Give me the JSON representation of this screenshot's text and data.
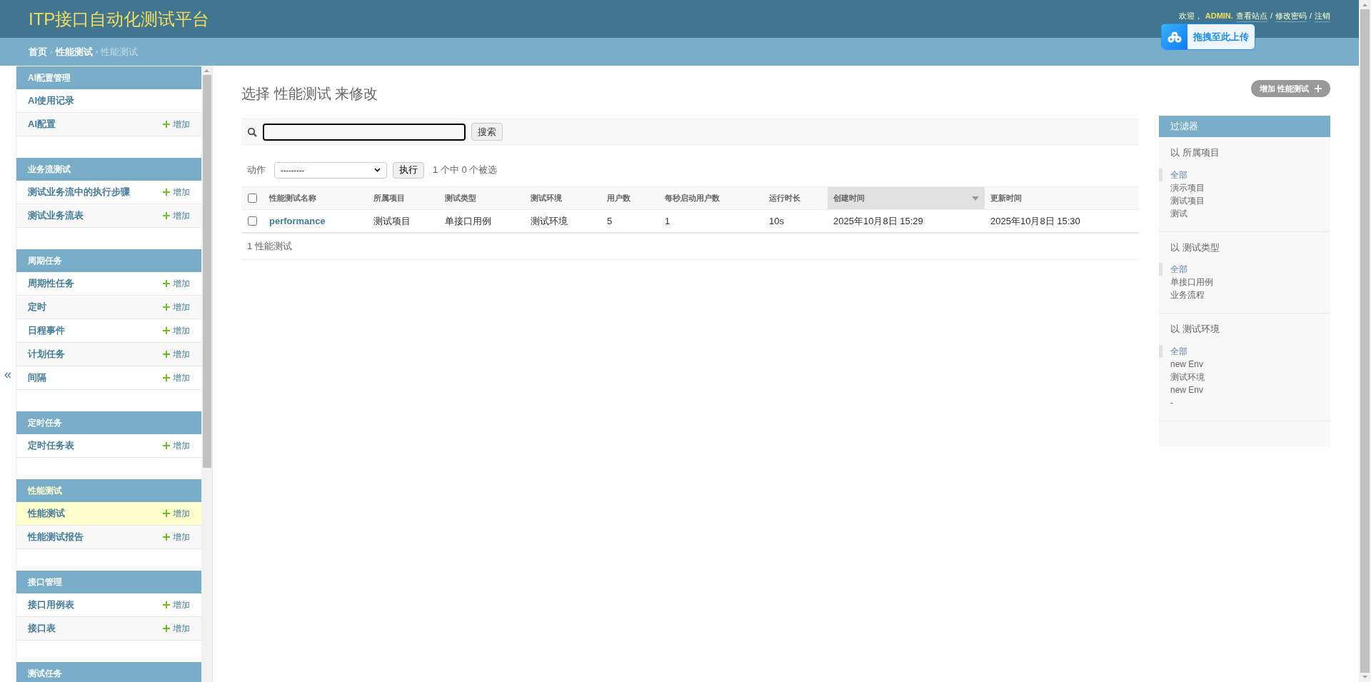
{
  "header": {
    "title": "ITP接口自动化测试平台",
    "welcome": "欢迎，",
    "user": "ADMIN.",
    "links": [
      "查看站点",
      "修改密码",
      "注销"
    ],
    "separator": "/"
  },
  "upload_widget": {
    "label": "拖拽至此上传"
  },
  "breadcrumbs": [
    {
      "label": "首页",
      "current": false
    },
    {
      "label": "性能测试",
      "current": false
    },
    {
      "label": "性能测试",
      "current": true
    }
  ],
  "breadcrumb_separator": "›",
  "collapse_button": "«",
  "sidebar": {
    "sections": [
      {
        "title": "AI配置管理",
        "current": false,
        "items": [
          {
            "label": "AI使用记录",
            "selected": false
          },
          {
            "label": "AI配置",
            "selected": false,
            "add": "增加"
          }
        ]
      },
      {
        "title": "业务流测试",
        "current": false,
        "items": [
          {
            "label": "测试业务流中的执行步骤",
            "selected": false,
            "add": "增加"
          },
          {
            "label": "测试业务流表",
            "selected": false,
            "add": "增加"
          }
        ]
      },
      {
        "title": "周期任务",
        "current": false,
        "items": [
          {
            "label": "周期性任务",
            "selected": false,
            "add": "增加"
          },
          {
            "label": "定时",
            "selected": false,
            "add": "增加"
          },
          {
            "label": "日程事件",
            "selected": false,
            "add": "增加"
          },
          {
            "label": "计划任务",
            "selected": false,
            "add": "增加"
          },
          {
            "label": "间隔",
            "selected": false,
            "add": "增加"
          }
        ]
      },
      {
        "title": "定时任务",
        "current": false,
        "items": [
          {
            "label": "定时任务表",
            "selected": false,
            "add": "增加"
          }
        ]
      },
      {
        "title": "性能测试",
        "current": true,
        "items": [
          {
            "label": "性能测试",
            "selected": true,
            "add": "增加"
          },
          {
            "label": "性能测试报告",
            "selected": false,
            "add": "增加"
          }
        ]
      },
      {
        "title": "接口管理",
        "current": false,
        "items": [
          {
            "label": "接口用例表",
            "selected": false,
            "add": "增加"
          },
          {
            "label": "接口表",
            "selected": false,
            "add": "增加"
          }
        ]
      },
      {
        "title": "测试任务",
        "current": false
      }
    ]
  },
  "page_title": "选择 性能测试 来修改",
  "add_button": "增加 性能测试",
  "search": {
    "button": "搜索"
  },
  "actions": {
    "label": "动作",
    "value": "---------",
    "go": "执行",
    "counter": "1 个中 0 个被选"
  },
  "table": {
    "select_all": {
      "checked": false
    },
    "columns": [
      {
        "label": "性能测试名称",
        "sorted": false
      },
      {
        "label": "所属项目",
        "sorted": false
      },
      {
        "label": "测试类型",
        "sorted": false
      },
      {
        "label": "测试环境",
        "sorted": false
      },
      {
        "label": "用户数",
        "sorted": false
      },
      {
        "label": "每秒启动用户数",
        "sorted": false
      },
      {
        "label": "运行时长",
        "sorted": false
      },
      {
        "label": "创建时间",
        "sorted": true
      },
      {
        "label": "更新时间",
        "sorted": false
      }
    ],
    "rows": [
      {
        "selected": false,
        "cells": [
          "performance",
          "测试项目",
          "单接口用例",
          "测试环境",
          "5",
          "1",
          "10s",
          "2025年10月8日 15:29",
          "2025年10月8日 15:30"
        ]
      }
    ]
  },
  "paginator": "1 性能测试",
  "filter": {
    "title": "过滤器",
    "groups": [
      {
        "title": "以 所属项目",
        "options": [
          {
            "label": "全部",
            "selected": true
          },
          {
            "label": "演示项目",
            "selected": false
          },
          {
            "label": "测试项目",
            "selected": false
          },
          {
            "label": "测试",
            "selected": false
          }
        ]
      },
      {
        "title": "以 测试类型",
        "options": [
          {
            "label": "全部",
            "selected": true
          },
          {
            "label": "单接口用例",
            "selected": false
          },
          {
            "label": "业务流程",
            "selected": false
          }
        ]
      },
      {
        "title": "以 测试环境",
        "options": [
          {
            "label": "全部",
            "selected": true
          },
          {
            "label": "new Env",
            "selected": false
          },
          {
            "label": "测试环境",
            "selected": false
          },
          {
            "label": "new Env",
            "selected": false
          },
          {
            "label": "-",
            "selected": false
          }
        ]
      }
    ]
  }
}
